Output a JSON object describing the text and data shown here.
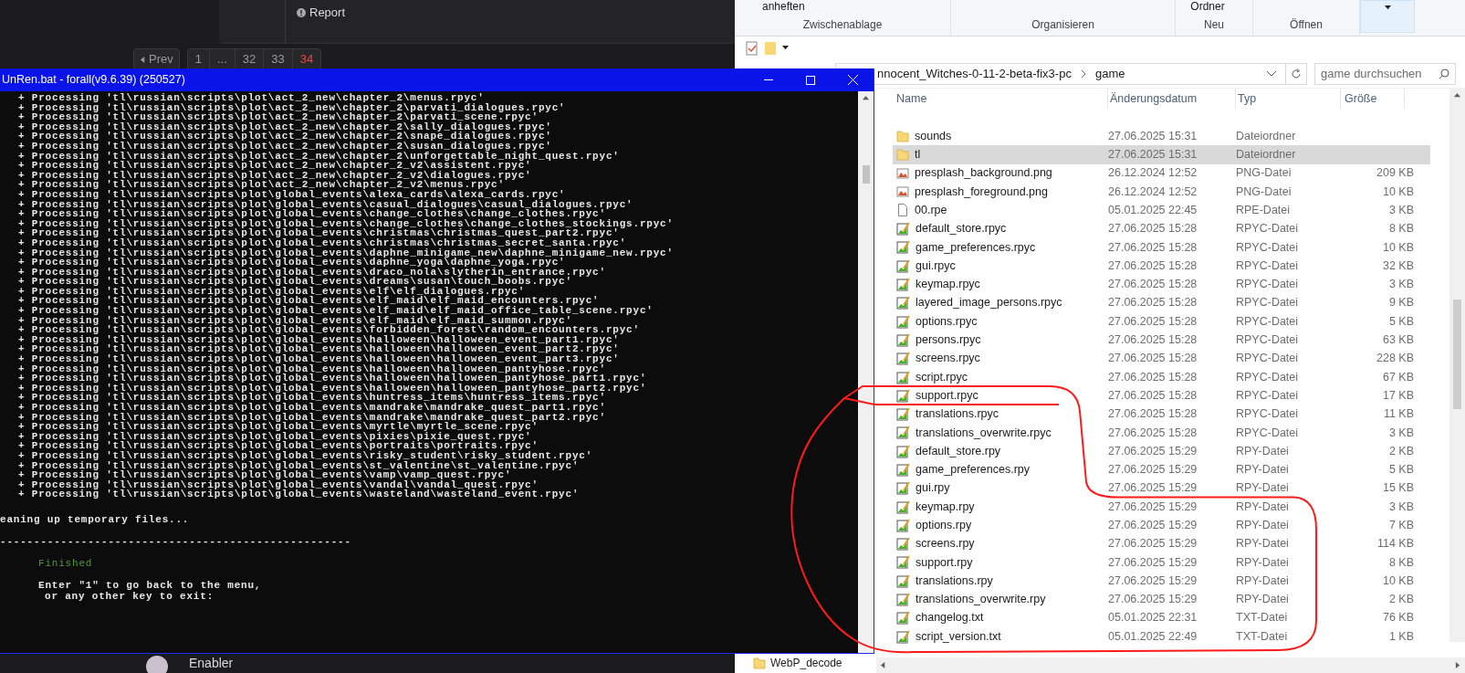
{
  "forum": {
    "report": "Report",
    "pagination": {
      "prev": "Prev",
      "pages": [
        {
          "label": "1",
          "selected": false
        },
        {
          "label": "...",
          "selected": false
        },
        {
          "label": "32",
          "selected": false
        },
        {
          "label": "33",
          "selected": false
        },
        {
          "label": "34",
          "selected": true
        }
      ]
    },
    "user": "Enabler"
  },
  "console": {
    "title": "UnRen.bat - forall(v9.6.39) (250527)",
    "lines": [
      "+ Processing 'tl\\russian\\scripts\\plot\\act_2_new\\chapter_2\\menus.rpyc'",
      "+ Processing 'tl\\russian\\scripts\\plot\\act_2_new\\chapter_2\\parvati_dialogues.rpyc'",
      "+ Processing 'tl\\russian\\scripts\\plot\\act_2_new\\chapter_2\\parvati_scene.rpyc'",
      "+ Processing 'tl\\russian\\scripts\\plot\\act_2_new\\chapter_2\\sally_dialogues.rpyc'",
      "+ Processing 'tl\\russian\\scripts\\plot\\act_2_new\\chapter_2\\snape_dialogues.rpyc'",
      "+ Processing 'tl\\russian\\scripts\\plot\\act_2_new\\chapter_2\\susan_dialogues.rpyc'",
      "+ Processing 'tl\\russian\\scripts\\plot\\act_2_new\\chapter_2\\unforgettable_night_quest.rpyc'",
      "+ Processing 'tl\\russian\\scripts\\plot\\act_2_new\\chapter_2_v2\\assistent.rpyc'",
      "+ Processing 'tl\\russian\\scripts\\plot\\act_2_new\\chapter_2_v2\\dialogues.rpyc'",
      "+ Processing 'tl\\russian\\scripts\\plot\\act_2_new\\chapter_2_v2\\menus.rpyc'",
      "+ Processing 'tl\\russian\\scripts\\plot\\global_events\\alexa_cards\\alexa_cards.rpyc'",
      "+ Processing 'tl\\russian\\scripts\\plot\\global_events\\casual_dialogues\\casual_dialogues.rpyc'",
      "+ Processing 'tl\\russian\\scripts\\plot\\global_events\\change_clothes\\change_clothes.rpyc'",
      "+ Processing 'tl\\russian\\scripts\\plot\\global_events\\change_clothes\\change_clothes_stockings.rpyc'",
      "+ Processing 'tl\\russian\\scripts\\plot\\global_events\\christmas\\christmas_quest_part2.rpyc'",
      "+ Processing 'tl\\russian\\scripts\\plot\\global_events\\christmas\\christmas_secret_santa.rpyc'",
      "+ Processing 'tl\\russian\\scripts\\plot\\global_events\\daphne_minigame_new\\daphne_minigame_new.rpyc'",
      "+ Processing 'tl\\russian\\scripts\\plot\\global_events\\daphne_yoga\\daphne_yoga.rpyc'",
      "+ Processing 'tl\\russian\\scripts\\plot\\global_events\\draco_nola\\slytherin_entrance.rpyc'",
      "+ Processing 'tl\\russian\\scripts\\plot\\global_events\\dreams\\susan\\touch_boobs.rpyc'",
      "+ Processing 'tl\\russian\\scripts\\plot\\global_events\\elf\\elf_dialogues.rpyc'",
      "+ Processing 'tl\\russian\\scripts\\plot\\global_events\\elf_maid\\elf_maid_encounters.rpyc'",
      "+ Processing 'tl\\russian\\scripts\\plot\\global_events\\elf_maid\\elf_maid_office_table_scene.rpyc'",
      "+ Processing 'tl\\russian\\scripts\\plot\\global_events\\elf_maid\\elf_maid_summon.rpyc'",
      "+ Processing 'tl\\russian\\scripts\\plot\\global_events\\forbidden_forest\\random_encounters.rpyc'",
      "+ Processing 'tl\\russian\\scripts\\plot\\global_events\\halloween\\halloween_event_part1.rpyc'",
      "+ Processing 'tl\\russian\\scripts\\plot\\global_events\\halloween\\halloween_event_part2.rpyc'",
      "+ Processing 'tl\\russian\\scripts\\plot\\global_events\\halloween\\halloween_event_part3.rpyc'",
      "+ Processing 'tl\\russian\\scripts\\plot\\global_events\\halloween\\halloween_pantyhose.rpyc'",
      "+ Processing 'tl\\russian\\scripts\\plot\\global_events\\halloween\\halloween_pantyhose_part1.rpyc'",
      "+ Processing 'tl\\russian\\scripts\\plot\\global_events\\halloween\\halloween_pantyhose_part2.rpyc'",
      "+ Processing 'tl\\russian\\scripts\\plot\\global_events\\huntress_items\\huntress_items.rpyc'",
      "+ Processing 'tl\\russian\\scripts\\plot\\global_events\\mandrake\\mandrake_quest_part1.rpyc'",
      "+ Processing 'tl\\russian\\scripts\\plot\\global_events\\mandrake\\mandrake_quest_part2.rpyc'",
      "+ Processing 'tl\\russian\\scripts\\plot\\global_events\\myrtle\\myrtle_scene.rpyc'",
      "+ Processing 'tl\\russian\\scripts\\plot\\global_events\\pixies\\pixie_quest.rpyc'",
      "+ Processing 'tl\\russian\\scripts\\plot\\global_events\\portraits\\portraits.rpyc'",
      "+ Processing 'tl\\russian\\scripts\\plot\\global_events\\risky_student\\risky_student.rpyc'",
      "+ Processing 'tl\\russian\\scripts\\plot\\global_events\\st_valentine\\st_valentine.rpyc'",
      "+ Processing 'tl\\russian\\scripts\\plot\\global_events\\vamp\\vamp_quest.rpyc'",
      "+ Processing 'tl\\russian\\scripts\\plot\\global_events\\vandal\\vandal_quest.rpyc'",
      "+ Processing 'tl\\russian\\scripts\\plot\\global_events\\wasteland\\wasteland_event.rpyc'"
    ],
    "cleanup": "eaning up temporary files...",
    "separator": "----------------------------------------------------",
    "status": "Finished",
    "prompt": [
      "Enter \"1\" to go back to the menu,",
      "or any other key to exit:"
    ]
  },
  "explorer": {
    "ribbon": {
      "items": [
        "anheften",
        "Ordner"
      ],
      "groups": [
        "Zwischenablage",
        "Organisieren",
        "Neu",
        "Öffnen"
      ]
    },
    "address": [
      "nnocent_Witches-0-11-2-beta-fix3-pc",
      "game"
    ],
    "search": {
      "placeholder": "game durchsuchen"
    },
    "columns": [
      "Name",
      "Änderungsdatum",
      "Typ",
      "Größe"
    ],
    "rows": [
      {
        "kind": "folder",
        "name": "sounds",
        "date": "27.06.2025 15:31",
        "type": "Dateiordner",
        "size": "",
        "selected": false
      },
      {
        "kind": "folder",
        "name": "tl",
        "date": "27.06.2025 15:31",
        "type": "Dateiordner",
        "size": "",
        "selected": true
      },
      {
        "kind": "image",
        "name": "presplash_background.png",
        "date": "26.12.2024 12:52",
        "type": "PNG-Datei",
        "size": "209 KB",
        "selected": false
      },
      {
        "kind": "image",
        "name": "presplash_foreground.png",
        "date": "26.12.2024 12:52",
        "type": "PNG-Datei",
        "size": "10 KB",
        "selected": false
      },
      {
        "kind": "blank",
        "name": "00.rpe",
        "date": "05.01.2025 22:45",
        "type": "RPE-Datei",
        "size": "3 KB",
        "selected": false
      },
      {
        "kind": "script",
        "name": "default_store.rpyc",
        "date": "27.06.2025 15:28",
        "type": "RPYC-Datei",
        "size": "8 KB",
        "selected": false
      },
      {
        "kind": "script",
        "name": "game_preferences.rpyc",
        "date": "27.06.2025 15:28",
        "type": "RPYC-Datei",
        "size": "10 KB",
        "selected": false
      },
      {
        "kind": "script",
        "name": "gui.rpyc",
        "date": "27.06.2025 15:28",
        "type": "RPYC-Datei",
        "size": "32 KB",
        "selected": false
      },
      {
        "kind": "script",
        "name": "keymap.rpyc",
        "date": "27.06.2025 15:28",
        "type": "RPYC-Datei",
        "size": "3 KB",
        "selected": false
      },
      {
        "kind": "script",
        "name": "layered_image_persons.rpyc",
        "date": "27.06.2025 15:28",
        "type": "RPYC-Datei",
        "size": "9 KB",
        "selected": false
      },
      {
        "kind": "script",
        "name": "options.rpyc",
        "date": "27.06.2025 15:28",
        "type": "RPYC-Datei",
        "size": "5 KB",
        "selected": false
      },
      {
        "kind": "script",
        "name": "persons.rpyc",
        "date": "27.06.2025 15:28",
        "type": "RPYC-Datei",
        "size": "63 KB",
        "selected": false
      },
      {
        "kind": "script",
        "name": "screens.rpyc",
        "date": "27.06.2025 15:28",
        "type": "RPYC-Datei",
        "size": "228 KB",
        "selected": false
      },
      {
        "kind": "script",
        "name": "script.rpyc",
        "date": "27.06.2025 15:28",
        "type": "RPYC-Datei",
        "size": "67 KB",
        "selected": false
      },
      {
        "kind": "script",
        "name": "support.rpyc",
        "date": "27.06.2025 15:28",
        "type": "RPYC-Datei",
        "size": "17 KB",
        "selected": false
      },
      {
        "kind": "script",
        "name": "translations.rpyc",
        "date": "27.06.2025 15:28",
        "type": "RPYC-Datei",
        "size": "11 KB",
        "selected": false
      },
      {
        "kind": "script",
        "name": "translations_overwrite.rpyc",
        "date": "27.06.2025 15:28",
        "type": "RPYC-Datei",
        "size": "3 KB",
        "selected": false
      },
      {
        "kind": "script",
        "name": "default_store.rpy",
        "date": "27.06.2025 15:29",
        "type": "RPY-Datei",
        "size": "2 KB",
        "selected": false
      },
      {
        "kind": "script",
        "name": "game_preferences.rpy",
        "date": "27.06.2025 15:29",
        "type": "RPY-Datei",
        "size": "5 KB",
        "selected": false
      },
      {
        "kind": "script",
        "name": "gui.rpy",
        "date": "27.06.2025 15:29",
        "type": "RPY-Datei",
        "size": "15 KB",
        "selected": false
      },
      {
        "kind": "script",
        "name": "keymap.rpy",
        "date": "27.06.2025 15:29",
        "type": "RPY-Datei",
        "size": "3 KB",
        "selected": false
      },
      {
        "kind": "script",
        "name": "options.rpy",
        "date": "27.06.2025 15:29",
        "type": "RPY-Datei",
        "size": "7 KB",
        "selected": false
      },
      {
        "kind": "script",
        "name": "screens.rpy",
        "date": "27.06.2025 15:29",
        "type": "RPY-Datei",
        "size": "114 KB",
        "selected": false
      },
      {
        "kind": "script",
        "name": "support.rpy",
        "date": "27.06.2025 15:29",
        "type": "RPY-Datei",
        "size": "8 KB",
        "selected": false
      },
      {
        "kind": "script",
        "name": "translations.rpy",
        "date": "27.06.2025 15:29",
        "type": "RPY-Datei",
        "size": "10 KB",
        "selected": false
      },
      {
        "kind": "script",
        "name": "translations_overwrite.rpy",
        "date": "27.06.2025 15:29",
        "type": "RPY-Datei",
        "size": "2 KB",
        "selected": false
      },
      {
        "kind": "script",
        "name": "changelog.txt",
        "date": "05.01.2025 22:31",
        "type": "TXT-Datei",
        "size": "76 KB",
        "selected": false
      },
      {
        "kind": "script",
        "name": "script_version.txt",
        "date": "05.01.2025 22:49",
        "type": "TXT-Datei",
        "size": "1 KB",
        "selected": false
      }
    ],
    "nav_item": "WebP_decode"
  }
}
